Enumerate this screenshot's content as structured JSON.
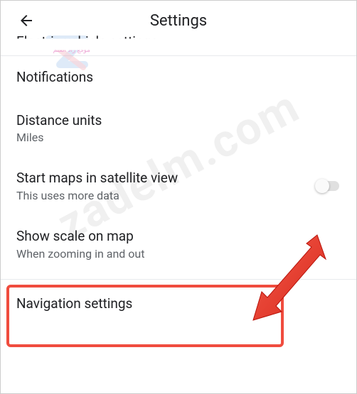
{
  "header": {
    "title": "Settings"
  },
  "prev_item": {
    "title": "Electric vehicle settings"
  },
  "notifications": {
    "title": "Notifications"
  },
  "distance_units": {
    "title": "Distance units",
    "value": "Miles"
  },
  "satellite": {
    "title": "Start maps in satellite view",
    "sub": "This uses more data",
    "enabled": false
  },
  "show_scale": {
    "title": "Show scale on map",
    "sub": "When zooming in and out"
  },
  "navigation": {
    "title": "Navigation settings"
  },
  "watermark": {
    "text": "zadelm.com",
    "logo_arabic": "موقع زاد العلم"
  },
  "colors": {
    "highlight": "#f04c3e",
    "arrow": "#e5352d"
  }
}
